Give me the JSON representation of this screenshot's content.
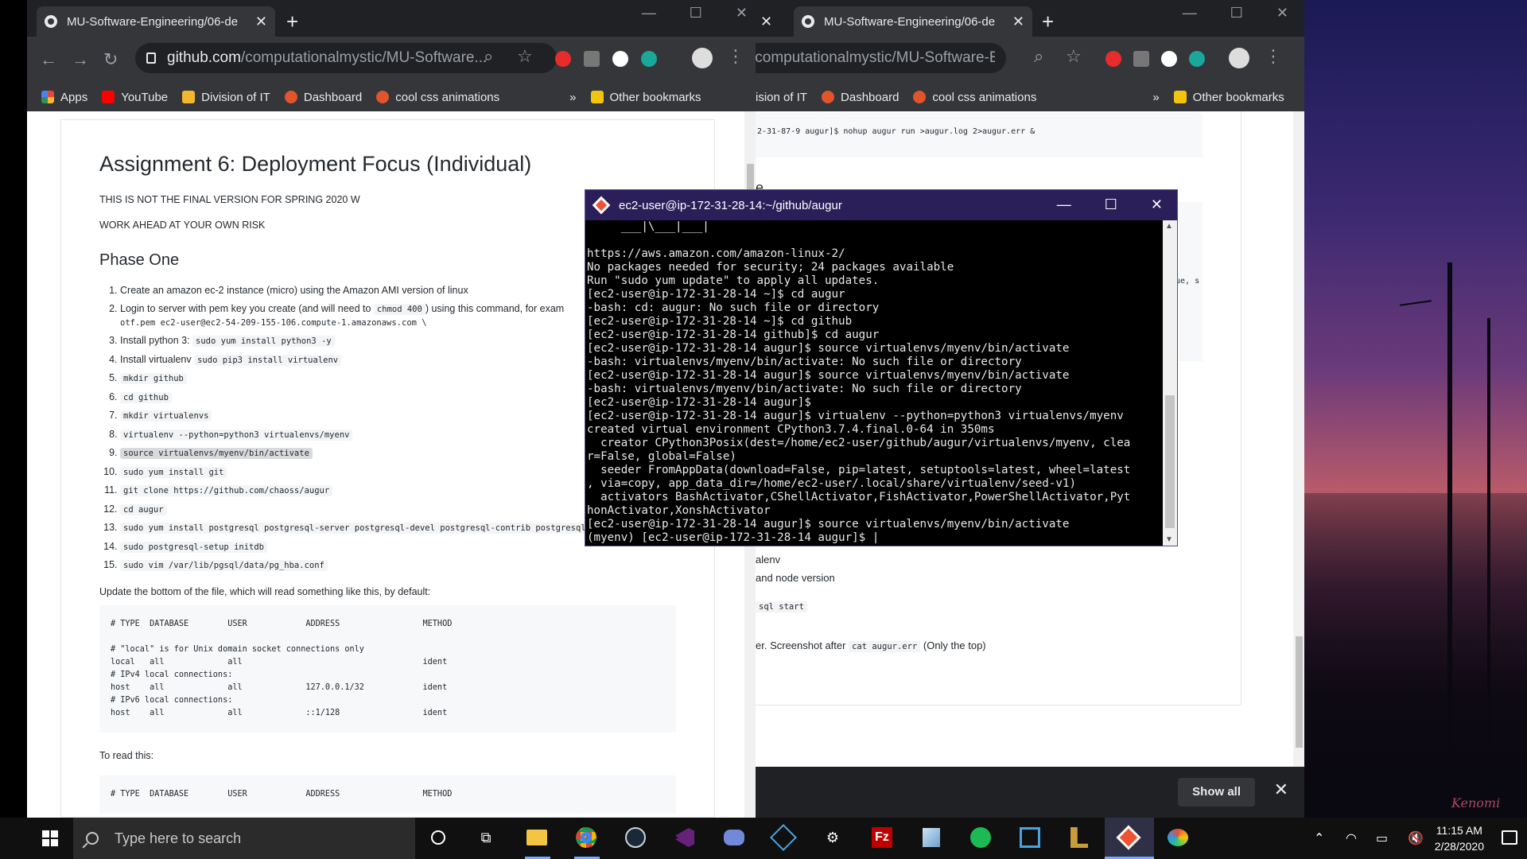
{
  "left_window": {
    "tab_title": "MU-Software-Engineering/06-de",
    "url_host": "github.com",
    "url_path": "/computationalmystic/MU-Software...",
    "bookmarks": [
      {
        "label": "Apps",
        "color": "#e8453c"
      },
      {
        "label": "YouTube",
        "color": "#ff0000"
      },
      {
        "label": "Division of IT",
        "color": "#f1b82d"
      },
      {
        "label": "Dashboard",
        "color": "#e2542a"
      },
      {
        "label": "cool css animations",
        "color": "#e2542a"
      }
    ],
    "more": "»",
    "other_bookmarks": "Other bookmarks"
  },
  "doc": {
    "title": "Assignment 6: Deployment Focus (Individual)",
    "note1": "THIS IS NOT THE FINAL VERSION FOR SPRING 2020 W",
    "note2": "WORK AHEAD AT YOUR OWN RISK",
    "phase": "Phase One",
    "steps": [
      {
        "text": "Create an amazon ec-2 instance (micro) using the Amazon AMI version of linux",
        "code": ""
      },
      {
        "text": "Login to server with pem key you create (and will need to ",
        "code": "chmod 400",
        "after": ") using this command, for exam",
        "line2": "otf.pem ec2-user@ec2-54-209-155-106.compute-1.amazonaws.com \\"
      },
      {
        "text": "Install python 3: ",
        "code": "sudo yum install python3 -y"
      },
      {
        "text": "Install virtualenv ",
        "code": "sudo pip3 install virtualenv"
      },
      {
        "text": "",
        "code": "mkdir github"
      },
      {
        "text": "",
        "code": "cd github"
      },
      {
        "text": "",
        "code": "mkdir virtualenvs"
      },
      {
        "text": "",
        "code": "virtualenv --python=python3 virtualenvs/myenv"
      },
      {
        "text": "",
        "code": "source virtualenvs/myenv/bin/activate",
        "highlight": true
      },
      {
        "text": "",
        "code": "sudo yum install git"
      },
      {
        "text": "",
        "code": "git clone https://github.com/chaoss/augur"
      },
      {
        "text": "",
        "code": "cd augur"
      },
      {
        "text": "",
        "code": "sudo yum install postgresql postgresql-server postgresql-devel postgresql-contrib postgresql-d"
      },
      {
        "text": "",
        "code": "sudo postgresql-setup initdb"
      },
      {
        "text": "",
        "code": "sudo vim /var/lib/pgsql/data/pg_hba.conf"
      }
    ],
    "update_text": "Update the bottom of the file, which will read something like this, by default:",
    "pg_default": "# TYPE  DATABASE        USER            ADDRESS                 METHOD\n\n# \"local\" is for Unix domain socket connections only\nlocal   all             all                                     ident\n# IPv4 local connections:\nhost    all             all             127.0.0.1/32            ident\n# IPv6 local connections:\nhost    all             all             ::1/128                 ident",
    "to_read": "To read this:",
    "pg_new_header": "# TYPE  DATABASE        USER            ADDRESS                 METHOD"
  },
  "right_window": {
    "tab_title": "MU-Software-Engineering/06-de",
    "url_path": "/computationalmystic/MU-Software-Engi...",
    "bookmarks_visible": [
      "ision of IT",
      "Dashboard",
      "cool css animations"
    ],
    "more": "»",
    "other_bookmarks": "Other bookmarks",
    "cmd_line": "2-31-87-9 augur]$ nohup augur run >augur.log 2>augur.err &",
    "heading_fragment": "e",
    "side_frag": "jue, s",
    "item_virtualenv": "alenv",
    "item_node": "and node version",
    "item_pgsql": "sql start",
    "screenshot_text": "er. Screenshot after ",
    "screenshot_code": "cat augur.err",
    "screenshot_after": " (Only the top)",
    "show_all": "Show all"
  },
  "terminal": {
    "title": "ec2-user@ip-172-31-28-14:~/github/augur",
    "lines": "     ___|\\___|___|\n\nhttps://aws.amazon.com/amazon-linux-2/\nNo packages needed for security; 24 packages available\nRun \"sudo yum update\" to apply all updates.\n[ec2-user@ip-172-31-28-14 ~]$ cd augur\n-bash: cd: augur: No such file or directory\n[ec2-user@ip-172-31-28-14 ~]$ cd github\n[ec2-user@ip-172-31-28-14 github]$ cd augur\n[ec2-user@ip-172-31-28-14 augur]$ source virtualenvs/myenv/bin/activate\n-bash: virtualenvs/myenv/bin/activate: No such file or directory\n[ec2-user@ip-172-31-28-14 augur]$ source virtualenvs/myenv/bin/activate\n-bash: virtualenvs/myenv/bin/activate: No such file or directory\n[ec2-user@ip-172-31-28-14 augur]$\n[ec2-user@ip-172-31-28-14 augur]$ virtualenv --python=python3 virtualenvs/myenv\ncreated virtual environment CPython3.7.4.final.0-64 in 350ms\n  creator CPython3Posix(dest=/home/ec2-user/github/augur/virtualenvs/myenv, clea\nr=False, global=False)\n  seeder FromAppData(download=False, pip=latest, setuptools=latest, wheel=latest\n, via=copy, app_data_dir=/home/ec2-user/.local/share/virtualenv/seed-v1)\n  activators BashActivator,CShellActivator,FishActivator,PowerShellActivator,Pyt\nhonActivator,XonshActivator\n[ec2-user@ip-172-31-28-14 augur]$ source virtualenvs/myenv/bin/activate\n(myenv) [ec2-user@ip-172-31-28-14 augur]$ |"
  },
  "taskbar": {
    "search_placeholder": "Type here to search",
    "time": "11:15 AM",
    "date": "2/28/2020"
  },
  "wallpaper_signature": "Kenomi"
}
